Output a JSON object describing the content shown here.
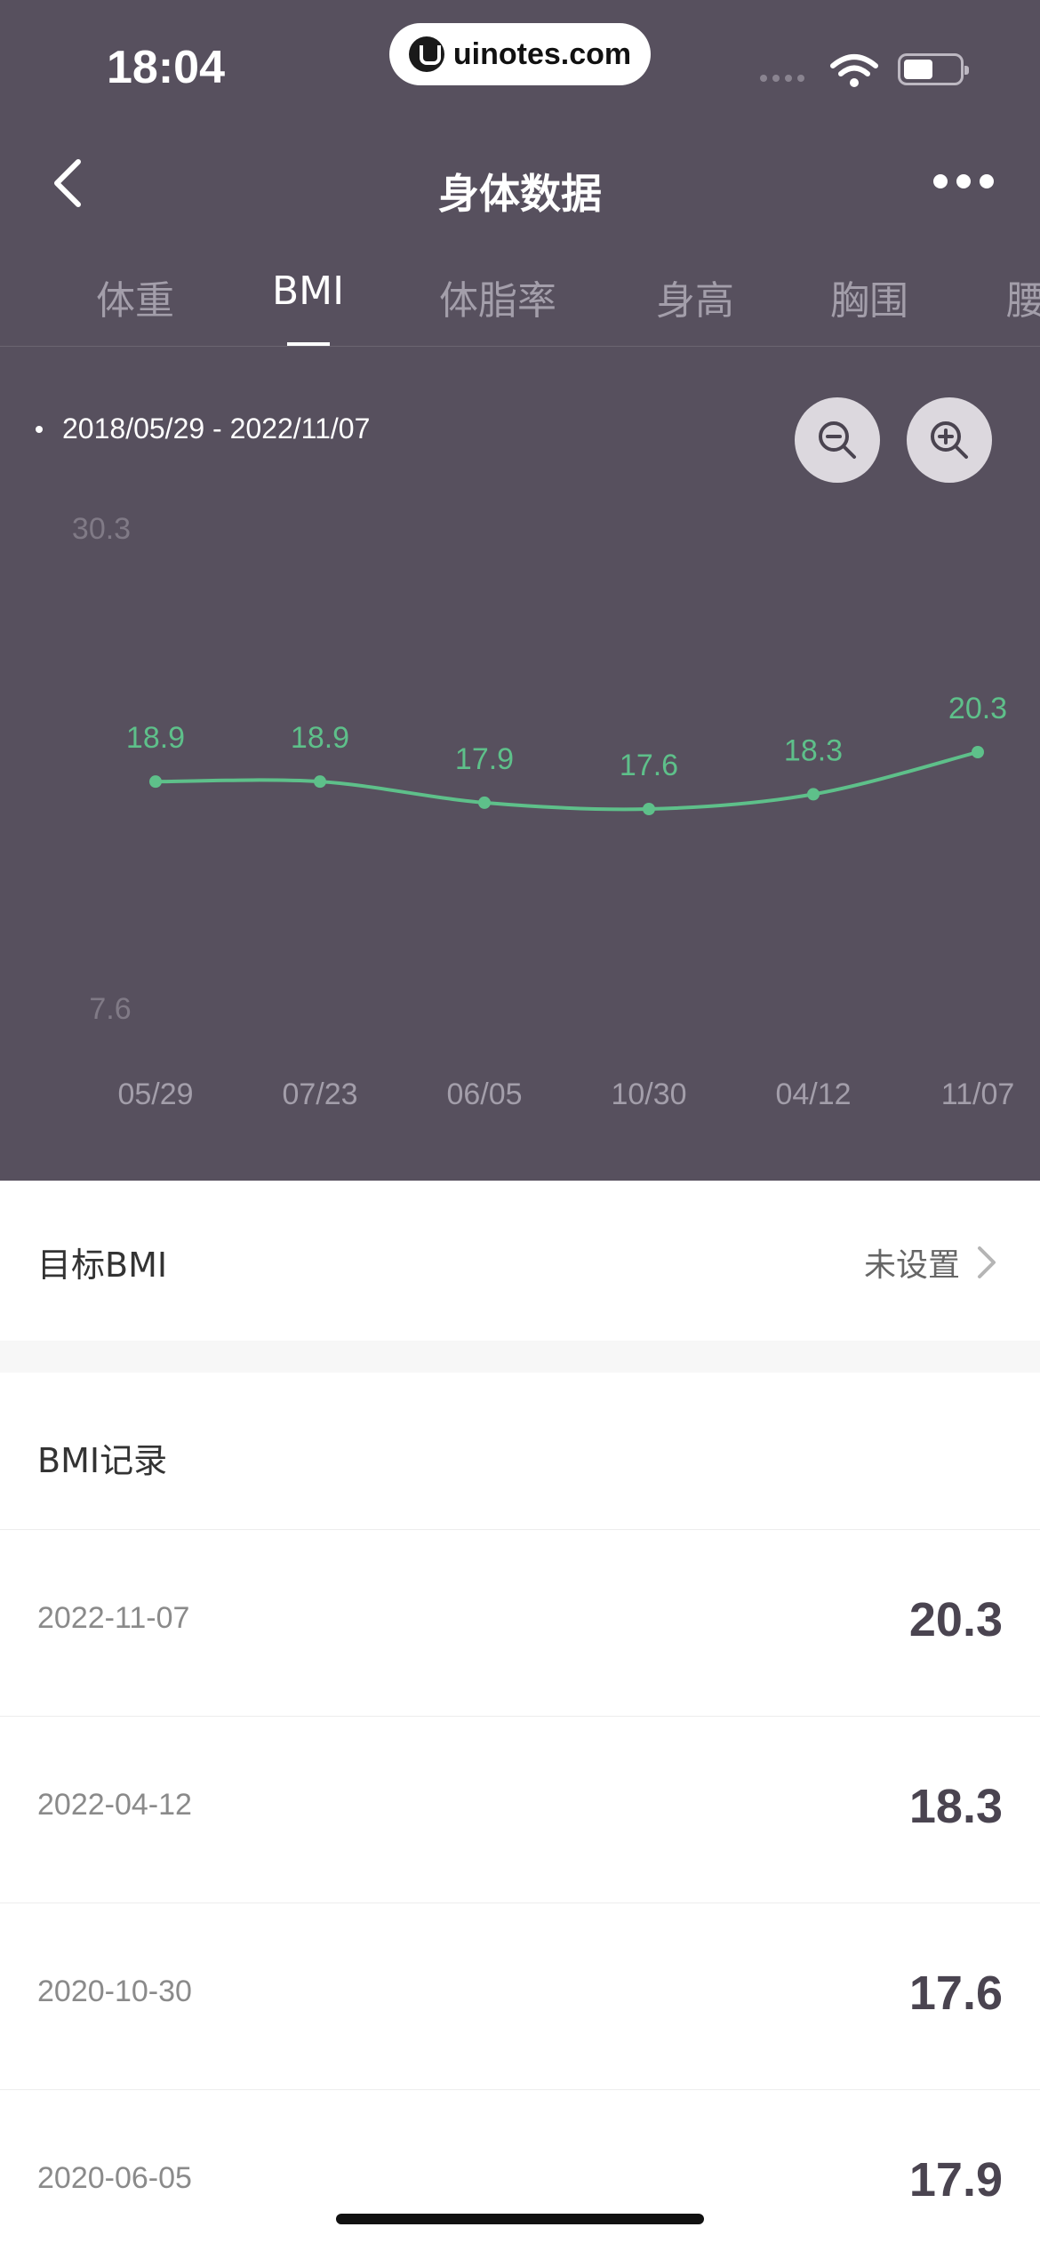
{
  "status_bar": {
    "time": "18:04",
    "watermark": "uinotes.com",
    "icons": [
      "signal-icon",
      "wifi-icon",
      "battery-icon"
    ]
  },
  "nav": {
    "title": "身体数据",
    "back_icon": "chevron-left-icon",
    "more_icon": "more-icon"
  },
  "tabs": [
    {
      "label": "体重",
      "active": false
    },
    {
      "label": "BMI",
      "active": true
    },
    {
      "label": "体脂率",
      "active": false
    },
    {
      "label": "身高",
      "active": false
    },
    {
      "label": "胸围",
      "active": false
    },
    {
      "label": "腰",
      "active": false
    }
  ],
  "range_text": "2018/05/29 - 2022/11/07",
  "zoom": {
    "out_icon": "zoom-out-icon",
    "in_icon": "zoom-in-icon"
  },
  "chart_data": {
    "type": "line",
    "x": [
      "05/29",
      "07/23",
      "06/05",
      "10/30",
      "04/12",
      "11/07"
    ],
    "series": [
      {
        "values": [
          18.9,
          18.9,
          17.9,
          17.6,
          18.3,
          20.3
        ],
        "color": "#5ec08a"
      }
    ],
    "y_tick_labels": [
      "30.3",
      "7.6"
    ],
    "ylim": [
      7.6,
      30.3
    ],
    "grid": false
  },
  "goal": {
    "label": "目标BMI",
    "value": "未设置"
  },
  "records": {
    "title": "BMI记录",
    "items": [
      {
        "date": "2022-11-07",
        "value": "20.3"
      },
      {
        "date": "2022-04-12",
        "value": "18.3"
      },
      {
        "date": "2020-10-30",
        "value": "17.6"
      },
      {
        "date": "2020-06-05",
        "value": "17.9"
      }
    ]
  },
  "colors": {
    "header_bg": "#57505e",
    "accent": "#5ec08a",
    "value_text": "#4a4450"
  }
}
